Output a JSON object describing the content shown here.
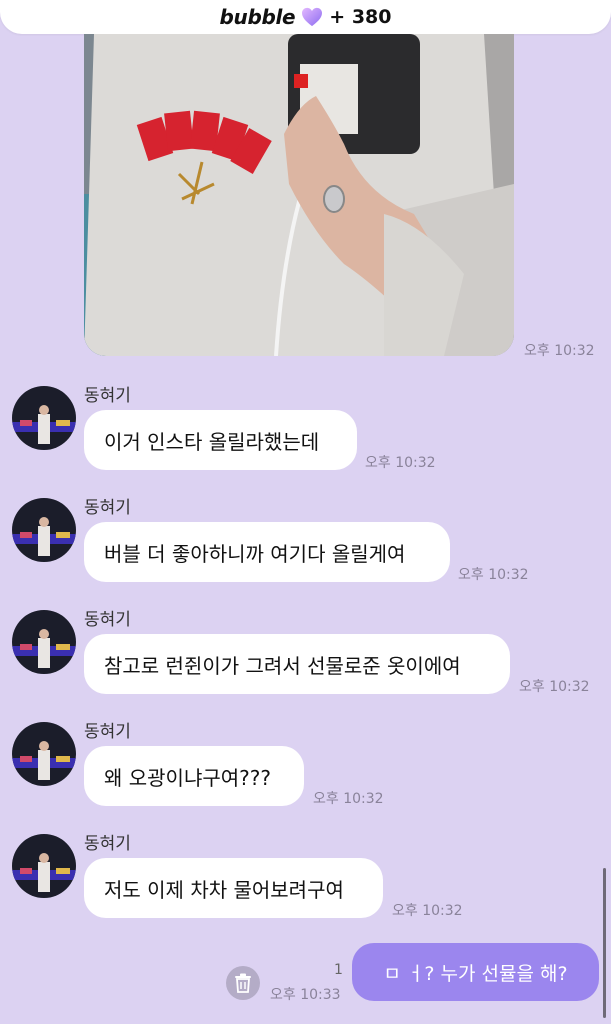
{
  "header": {
    "brand": "bubble",
    "count": "+ 380",
    "heart_color": "#b98cf2"
  },
  "photo": {
    "time": "오후 10:32"
  },
  "messages": [
    {
      "sender": "동혀기",
      "text": "이거 인스타 올릴라했는데",
      "time": "오후 10:32"
    },
    {
      "sender": "동혀기",
      "text": "버블 더 좋아하니까 여기다 올릴게여",
      "time": "오후 10:32"
    },
    {
      "sender": "동혀기",
      "text": "참고로 런쥔이가 그려서 선물로준 옷이에여",
      "time": "오후 10:32"
    },
    {
      "sender": "동혀기",
      "text": "왜 오광이냐구여???",
      "time": "오후 10:32"
    },
    {
      "sender": "동혀기",
      "text": "저도 이제 차차 물어보려구여",
      "time": "오후 10:32"
    }
  ],
  "my_message": {
    "text": "ㅁ ㅓ? 누가 선뮬을 해?",
    "time": "오후 10:33",
    "unread": "1",
    "color": "#9b86ee"
  }
}
